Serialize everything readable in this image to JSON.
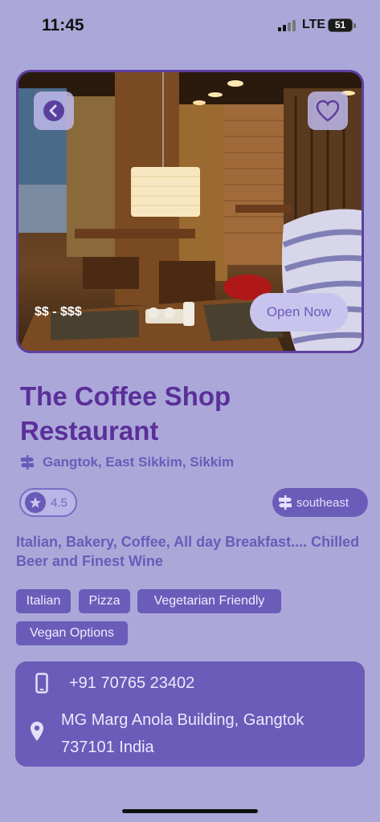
{
  "status": {
    "time": "11:45",
    "network": "LTE",
    "battery": "51"
  },
  "hero": {
    "price_range": "$$ - $$$",
    "open_status": "Open Now"
  },
  "restaurant": {
    "name": "The Coffee Shop Restaurant",
    "location": "Gangtok, East Sikkim, Sikkim",
    "rating": "4.5",
    "direction": "southeast",
    "cuisines": "Italian, Bakery, Coffee, All day Breakfast.... Chilled Beer and Finest Wine",
    "tags": [
      "Italian",
      "Pizza",
      "Vegetarian Friendly",
      "Vegan Options"
    ]
  },
  "contact": {
    "phone": "+91 70765 23402",
    "address": "MG Marg Anola Building, Gangtok 737101 India"
  },
  "icons": {
    "back": "chevron-left-icon",
    "favorite": "heart-icon",
    "location": "signpost-icon",
    "rating": "star-icon",
    "direction": "signpost-icon",
    "phone": "phone-icon",
    "address": "map-pin-icon"
  },
  "colors": {
    "background": "#aba8d9",
    "accent": "#6a5cb8",
    "title": "#5b2f9a"
  }
}
